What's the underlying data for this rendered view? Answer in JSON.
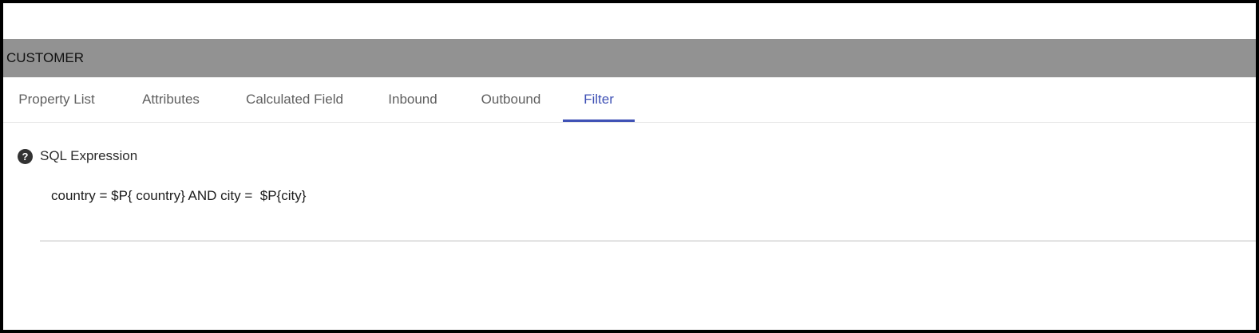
{
  "entity": {
    "title": "CUSTOMER"
  },
  "tabs": [
    {
      "label": "Property List",
      "active": false
    },
    {
      "label": "Attributes",
      "active": false
    },
    {
      "label": "Calculated Field",
      "active": false
    },
    {
      "label": "Inbound",
      "active": false
    },
    {
      "label": "Outbound",
      "active": false
    },
    {
      "label": "Filter",
      "active": true
    }
  ],
  "filter": {
    "help_icon": "question-circle-icon",
    "label": "SQL Expression",
    "expression": "country = $P{ country} AND city =  $P{city}"
  },
  "colors": {
    "accent": "#3f51b5",
    "header_bg": "#929292"
  }
}
